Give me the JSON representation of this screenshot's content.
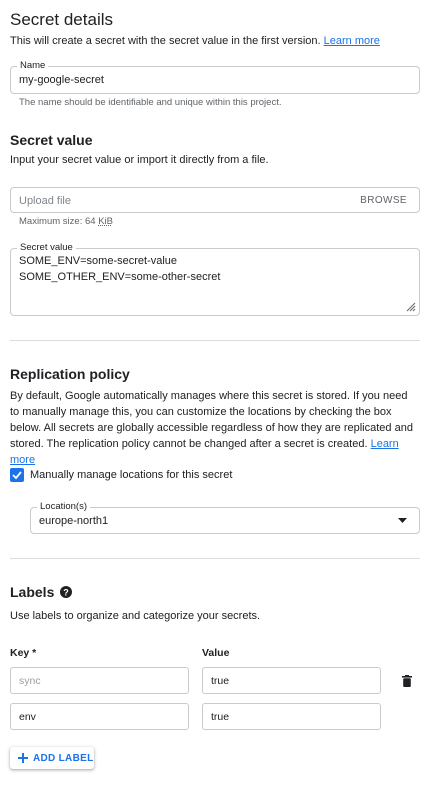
{
  "header": {
    "title": "Secret details",
    "description": "This will create a secret with the secret value in the first version.",
    "learn_more": "Learn more"
  },
  "name_field": {
    "label": "Name",
    "value": "my-google-secret",
    "hint": "The name should be identifiable and unique within this project."
  },
  "secret_value": {
    "title": "Secret value",
    "description": "Input your secret value or import it directly from a file.",
    "upload_placeholder": "Upload file",
    "browse_label": "BROWSE",
    "max_size_prefix": "Maximum size: 64 ",
    "max_size_unit": "KiB",
    "textarea_label": "Secret value",
    "lines": [
      "SOME_ENV=some-secret-value",
      "SOME_OTHER_ENV=some-other-secret"
    ]
  },
  "replication": {
    "title": "Replication policy",
    "description": "By default, Google automatically manages where this secret is stored. If you need to manually manage this, you can customize the locations by checking the box below. All secrets are globally accessible regardless of how they are replicated and stored. The replication policy cannot be changed after a secret is created.",
    "learn_more": "Learn more",
    "checkbox_label": "Manually manage locations for this secret",
    "checkbox_checked": true,
    "location_label": "Location(s)",
    "location_value": "europe-north1"
  },
  "labels": {
    "title": "Labels",
    "description": "Use labels to organize and categorize your secrets.",
    "key_header": "Key *",
    "value_header": "Value",
    "rows": [
      {
        "key": "sync",
        "value": "true"
      },
      {
        "key": "env",
        "value": "true"
      }
    ],
    "add_label": "ADD LABEL"
  },
  "colors": {
    "accent": "#1a73e8",
    "text": "#202124",
    "hint": "#5f6368",
    "divider": "#dadce0"
  },
  "icons": [
    "help-icon",
    "delete-icon",
    "plus-icon",
    "dropdown-arrow-icon",
    "check-icon",
    "resize-handle-icon"
  ]
}
